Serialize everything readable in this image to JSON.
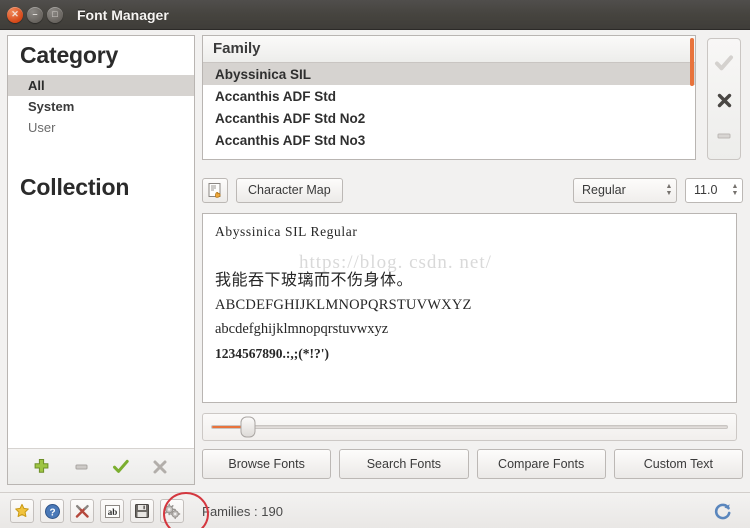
{
  "window": {
    "title": "Font Manager",
    "controls": {
      "close": "close-icon",
      "minimize": "minimize-icon",
      "maximize": "maximize-icon"
    }
  },
  "sidebar": {
    "category_header": "Category",
    "categories": [
      {
        "label": "All",
        "selected": true
      },
      {
        "label": "System",
        "selected": false
      },
      {
        "label": "User",
        "selected": false
      }
    ],
    "collection_header": "Collection",
    "collections": [],
    "toolbar": [
      {
        "name": "add-collection-button",
        "glyph": "✚",
        "color": "#8ab63a"
      },
      {
        "name": "remove-collection-button",
        "glyph": "—",
        "color": "#b5b1ae"
      },
      {
        "name": "enable-collection-button",
        "glyph": "✓",
        "color": "#7bae2f"
      },
      {
        "name": "disable-collection-button",
        "glyph": "✖",
        "color": "#b0acA8"
      }
    ]
  },
  "family_panel": {
    "header": "Family",
    "items": [
      {
        "label": "Abyssinica SIL",
        "selected": true
      },
      {
        "label": "Accanthis ADF Std",
        "selected": false
      },
      {
        "label": "Accanthis ADF Std No2",
        "selected": false
      },
      {
        "label": "Accanthis ADF Std No3",
        "selected": false
      }
    ],
    "scrollbar_color": "#e8733c"
  },
  "vertical_toolbar": [
    {
      "name": "enable-font-button",
      "glyph": "✓"
    },
    {
      "name": "disable-font-button",
      "glyph": "✖"
    },
    {
      "name": "remove-font-button",
      "glyph": "—"
    }
  ],
  "toolbar": {
    "character_map_icon": "character-map-icon",
    "character_map_label": "Character Map",
    "style_value": "Regular",
    "size_value": "11.0"
  },
  "preview": {
    "title": "Abyssinica  SIL  Regular",
    "cjk_sample": "我能吞下玻璃而不伤身体。",
    "uppercase": "ABCDEFGHIJKLMNOPQRSTUVWXYZ",
    "lowercase": "abcdefghijklmnopqrstuvwxyz",
    "numerals": "1234567890.:,;(*!?')",
    "watermark": "https://blog. csdn. net/"
  },
  "size_slider": {
    "fill_percent": 7,
    "fill_color": "#e8733c"
  },
  "mode_buttons": [
    {
      "label": "Browse Fonts"
    },
    {
      "label": "Search Fonts"
    },
    {
      "label": "Compare Fonts"
    },
    {
      "label": "Custom Text"
    }
  ],
  "statusbar": {
    "icons": [
      {
        "name": "favorites-star-icon",
        "glyph": "★",
        "color": "#e8b33a"
      },
      {
        "name": "help-icon",
        "glyph": "?",
        "color": "#ffffff",
        "bg": "#4a79b8"
      },
      {
        "name": "tools-icon",
        "glyph": "⚒",
        "color": "#b5483c"
      },
      {
        "name": "text-ab-icon",
        "glyph": "ab",
        "color": "#2b2b2b"
      },
      {
        "name": "save-icon",
        "glyph": "💾",
        "color": "#5a5a5a"
      },
      {
        "name": "settings-gears-icon",
        "glyph": "⚙",
        "color": "#8a8a8a"
      }
    ],
    "families_label": "Families : 190",
    "refresh_icon": "refresh-icon",
    "annotation_color": "#d4373f"
  }
}
